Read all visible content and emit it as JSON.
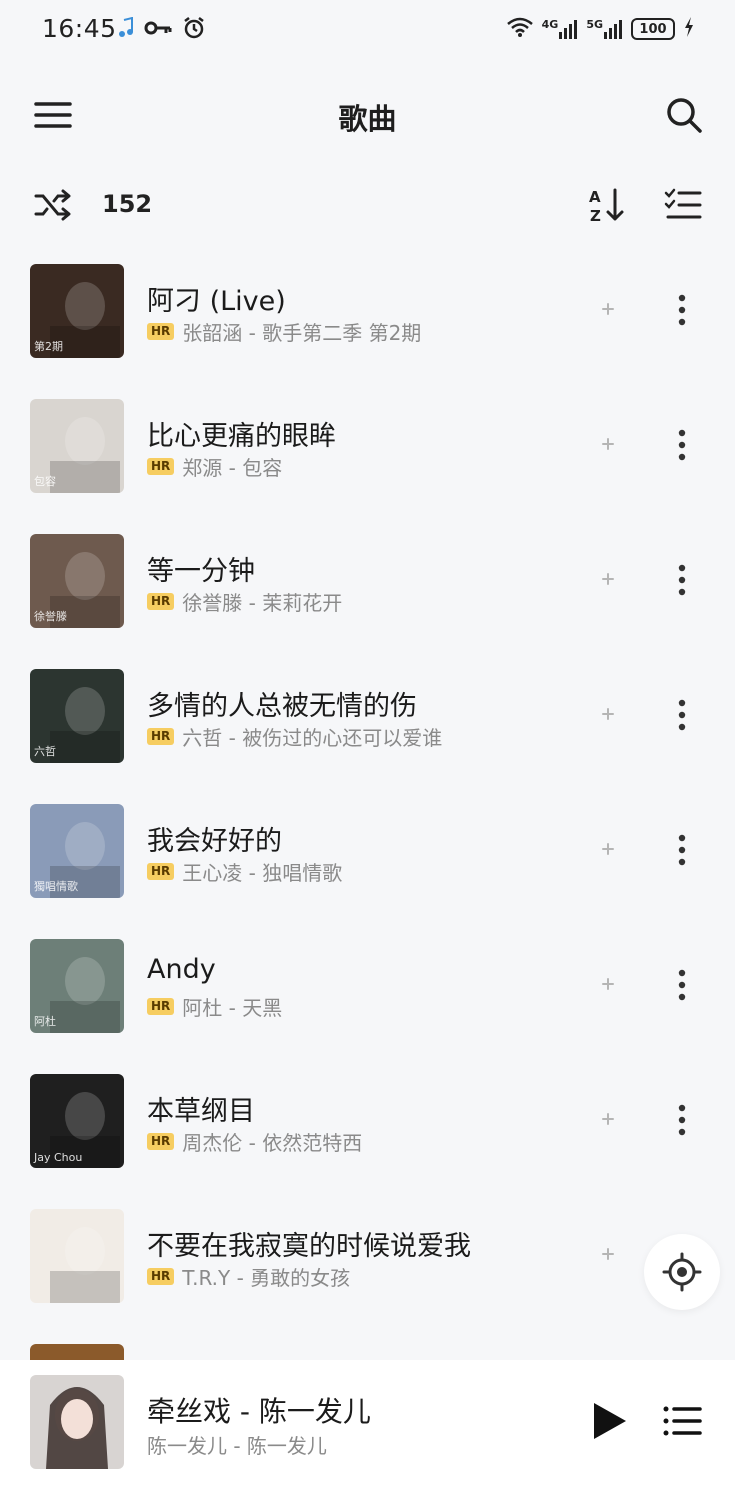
{
  "status_bar": {
    "time": "16:45",
    "net_label_1": "4G",
    "net_label_2": "5G",
    "battery": "100"
  },
  "header": {
    "title": "歌曲",
    "menu_icon": "hamburger-menu-icon",
    "search_icon": "search-icon"
  },
  "toolbar": {
    "count": "152",
    "shuffle_icon": "shuffle-icon",
    "sort_icon": "sort-az-icon",
    "select_icon": "checklist-icon"
  },
  "songs": [
    {
      "title": "阿刁 (Live)",
      "badge": "HR",
      "subtitle": "张韶涵 - 歌手第二季 第2期",
      "cover_text": "第2期",
      "cover_color": "#3a2a22"
    },
    {
      "title": "比心更痛的眼眸",
      "badge": "HR",
      "subtitle": "郑源 - 包容",
      "cover_text": "包容",
      "cover_color": "#d9d5d0"
    },
    {
      "title": "等一分钟",
      "badge": "HR",
      "subtitle": "徐誉滕 - 茉莉花开",
      "cover_text": "徐誉滕",
      "cover_color": "#6e5a4e"
    },
    {
      "title": "多情的人总被无情的伤",
      "badge": "HR",
      "subtitle": "六哲 - 被伤过的心还可以爱谁",
      "cover_text": "六哲",
      "cover_color": "#2c3530"
    },
    {
      "title": "我会好好的",
      "badge": "HR",
      "subtitle": "王心凌 - 独唱情歌",
      "cover_text": "獨唱情歌",
      "cover_color": "#8a9bb8"
    },
    {
      "title": "Andy",
      "badge": "HR",
      "subtitle": "阿杜 - 天黑",
      "cover_text": "阿杜",
      "cover_color": "#6d7f78"
    },
    {
      "title": "本草纲目",
      "badge": "HR",
      "subtitle": "周杰伦 - 依然范特西",
      "cover_text": "Jay Chou",
      "cover_color": "#1f1f1f"
    },
    {
      "title": "不要在我寂寞的时候说爱我",
      "badge": "HR",
      "subtitle": "T.R.Y - 勇敢的女孩",
      "cover_text": "",
      "cover_color": "#f1ece6"
    }
  ],
  "player": {
    "title": "牵丝戏 - 陈一发儿",
    "artist": "陈一发儿 - 陈一发儿",
    "play_icon": "play-icon",
    "queue_icon": "queue-list-icon"
  },
  "colors": {
    "background": "#f6f7f9",
    "hr_badge": "#f6cd61",
    "secondary_text": "#8a8a8a"
  }
}
